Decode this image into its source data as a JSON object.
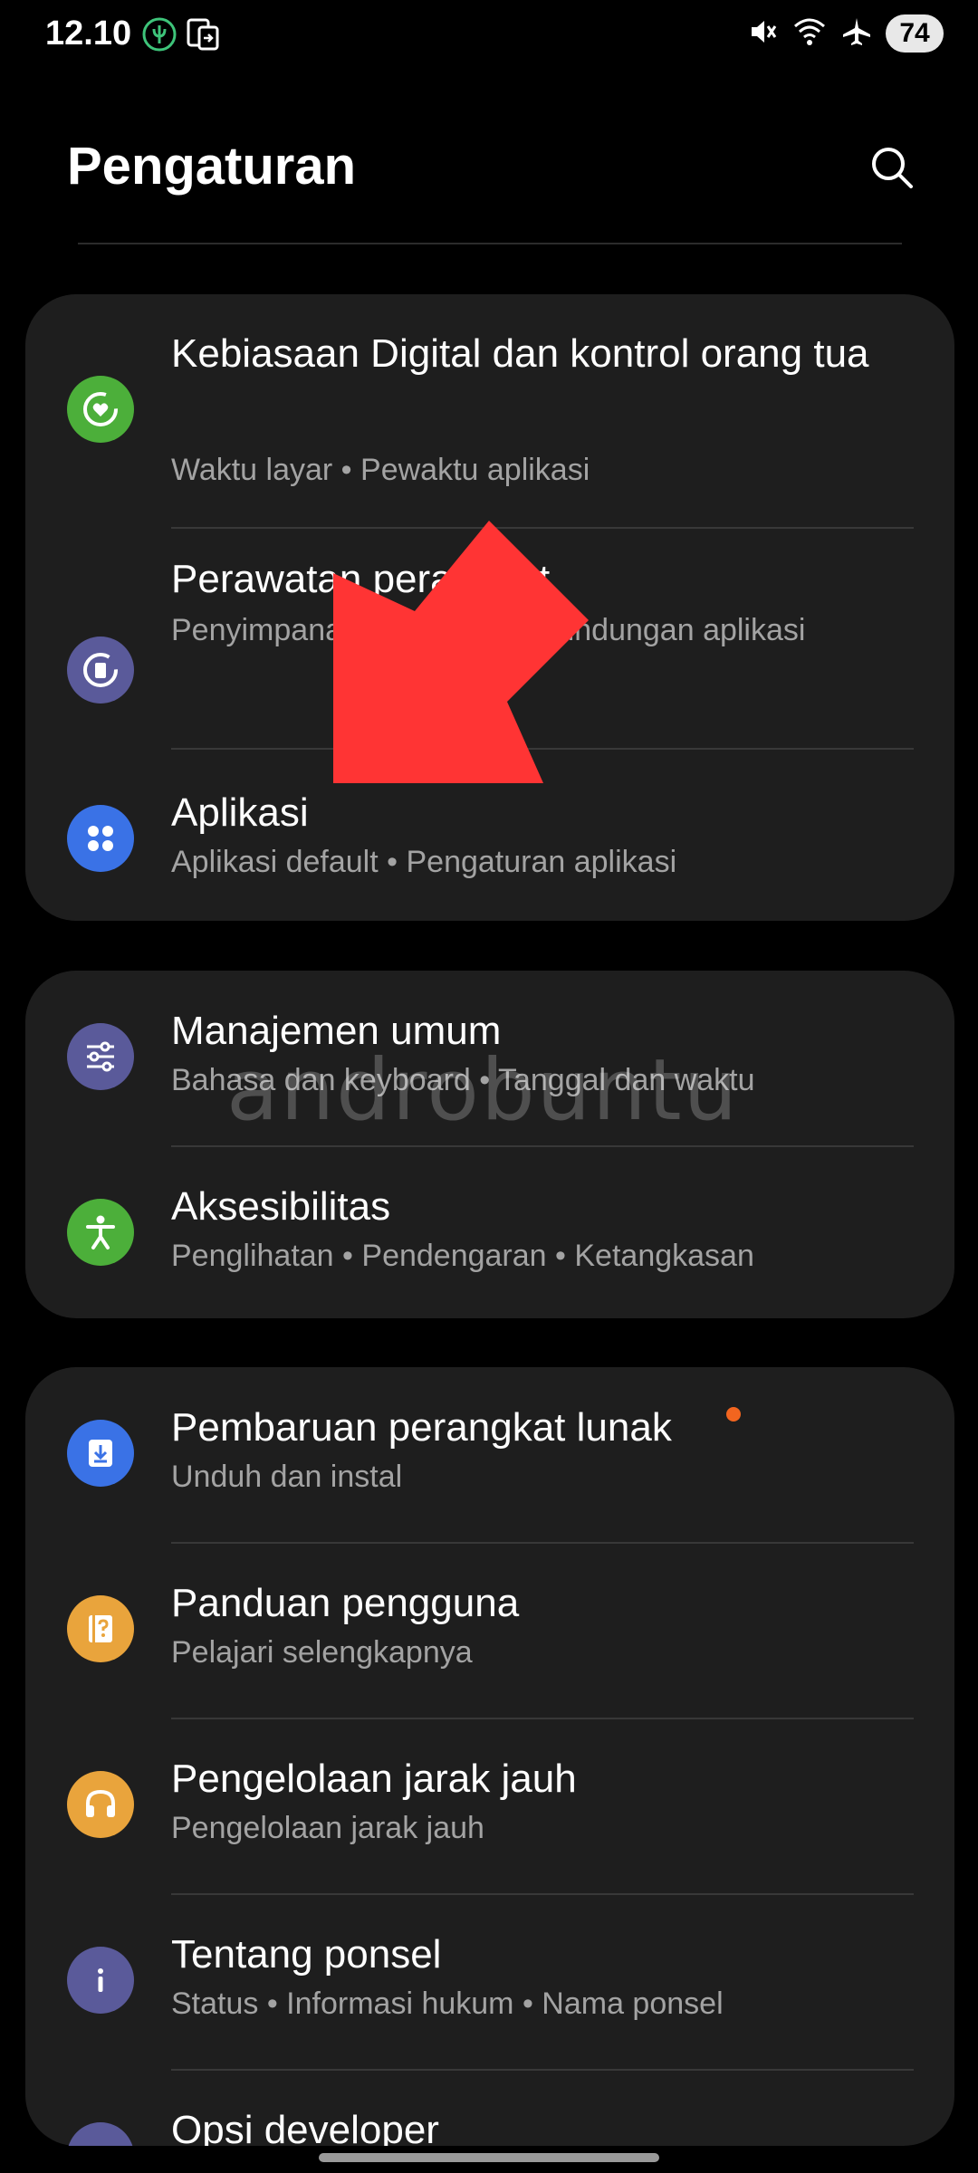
{
  "status_bar": {
    "time": "12.10",
    "battery": "74",
    "icons": [
      "nature-icon",
      "screen-share-icon",
      "mute-icon",
      "wifi-icon",
      "airplane-icon"
    ]
  },
  "header": {
    "title": "Pengaturan",
    "search_icon": "search-icon"
  },
  "groups": [
    {
      "items": [
        {
          "title": "Kebiasaan Digital dan kontrol orang tua",
          "subtitle": "Waktu layar  •  Pewaktu aplikasi",
          "icon": "digital-wellbeing-icon",
          "color": "#4caf3a"
        },
        {
          "title": "Perawatan perangkat",
          "subtitle": "Penyimpanan  •  Baterai  •  Perlindungan aplikasi",
          "icon": "device-care-icon",
          "color": "#5a5a9a"
        },
        {
          "title": "Aplikasi",
          "subtitle": "Aplikasi default  •  Pengaturan aplikasi",
          "icon": "apps-icon",
          "color": "#3a72e6"
        }
      ]
    },
    {
      "items": [
        {
          "title": "Manajemen umum",
          "subtitle": "Bahasa dan keyboard  •  Tanggal dan waktu",
          "icon": "sliders-icon",
          "color": "#5a5a9a"
        },
        {
          "title": "Aksesibilitas",
          "subtitle": "Penglihatan  •  Pendengaran  •  Ketangkasan",
          "icon": "accessibility-icon",
          "color": "#4caf3a"
        }
      ]
    },
    {
      "items": [
        {
          "title": "Pembaruan perangkat lunak",
          "subtitle": "Unduh dan instal",
          "icon": "software-update-icon",
          "color": "#3a72e6"
        },
        {
          "title": "Panduan pengguna",
          "subtitle": "Pelajari selengkapnya",
          "icon": "user-guide-icon",
          "color": "#e9a43c"
        },
        {
          "title": "Pengelolaan jarak jauh",
          "subtitle": "Pengelolaan jarak jauh",
          "icon": "headset-icon",
          "color": "#e9a43c"
        },
        {
          "title": "Tentang ponsel",
          "subtitle": "Status  •  Informasi hukum  •  Nama ponsel",
          "icon": "info-icon",
          "color": "#5a5a9a"
        },
        {
          "title": "Opsi developer",
          "subtitle": "",
          "icon": "developer-options-icon",
          "color": "#5a5a9a"
        }
      ]
    }
  ],
  "watermark": "androbuntu",
  "colors": {
    "background": "#000000",
    "card": "#1e1e1e",
    "subtitle": "#a3a3a3",
    "arrow": "#ff3434",
    "update_badge": "#f2651f"
  }
}
